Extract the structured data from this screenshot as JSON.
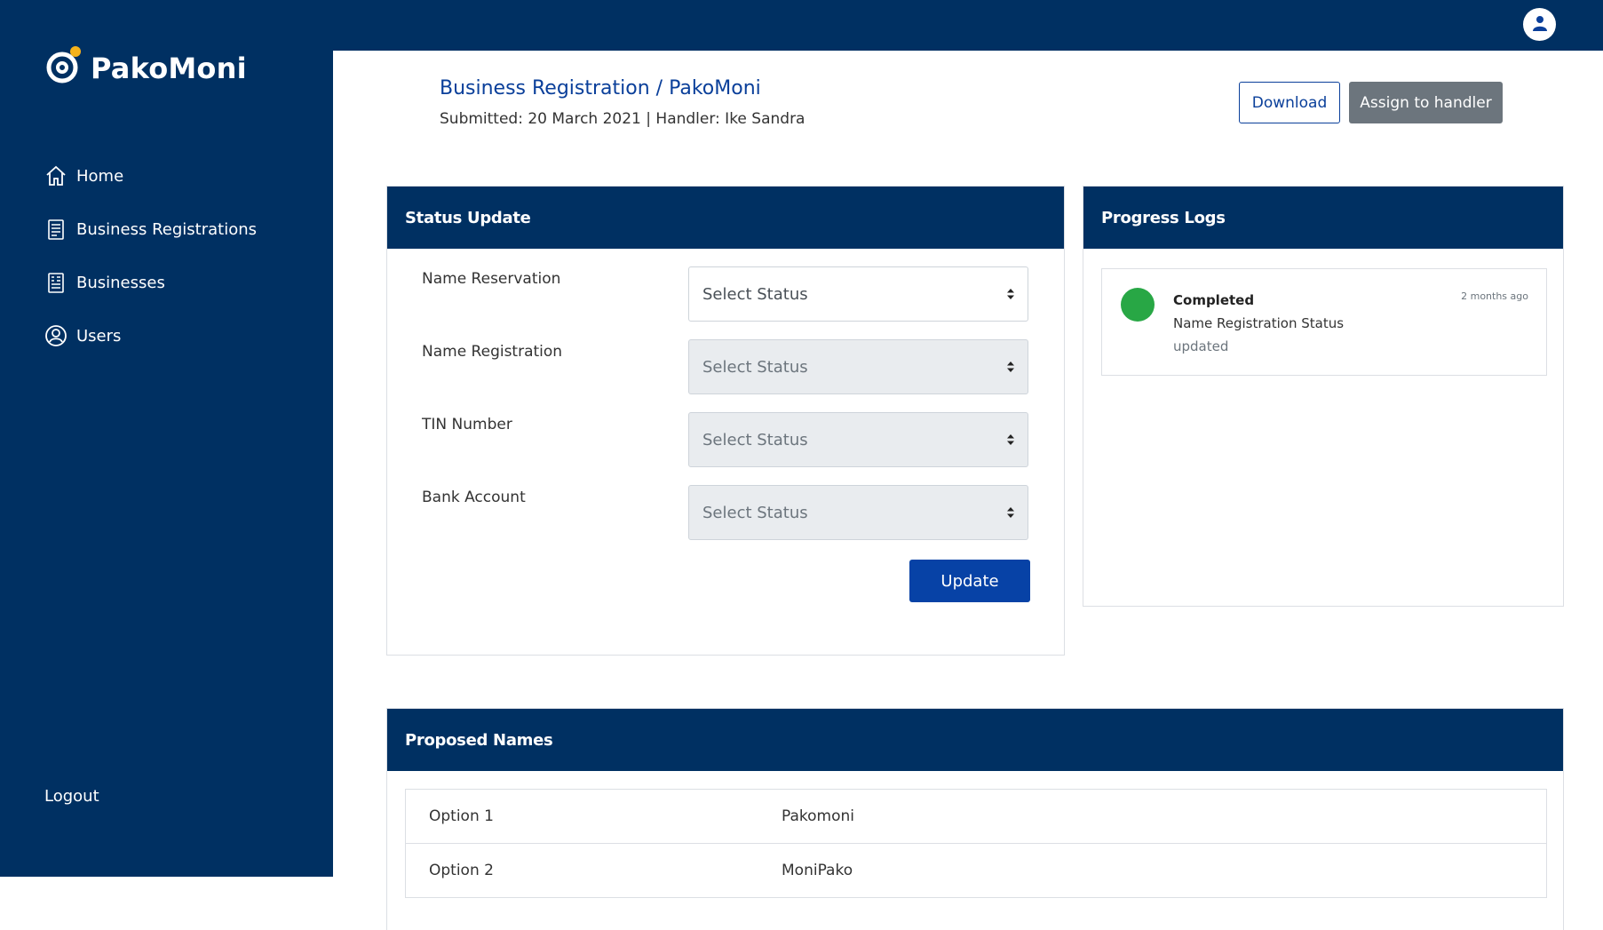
{
  "app": {
    "brand": "PakoMoni",
    "brand_color": "#003062",
    "accent_color": "#0a3f9a"
  },
  "sidebar": {
    "items": [
      {
        "label": "Home",
        "icon": "home-icon"
      },
      {
        "label": "Business Registrations",
        "icon": "document-icon"
      },
      {
        "label": "Businesses",
        "icon": "building-icon"
      },
      {
        "label": "Users",
        "icon": "user-circle-icon"
      }
    ],
    "logout_label": "Logout"
  },
  "header": {
    "title": "Business Registration / PakoMoni",
    "subtitle": "Submitted: 20 March 2021 | Handler: Ike Sandra",
    "download_label": "Download",
    "assign_label": "Assign to handler"
  },
  "status_update": {
    "title": "Status Update",
    "fields": [
      {
        "label": "Name Reservation",
        "value": "Select Status",
        "enabled": true
      },
      {
        "label": "Name Registration",
        "value": "Select Status",
        "enabled": false
      },
      {
        "label": "TIN Number",
        "value": "Select Status",
        "enabled": false
      },
      {
        "label": "Bank Account",
        "value": "Select Status",
        "enabled": false
      }
    ],
    "update_label": "Update"
  },
  "progress_logs": {
    "title": "Progress Logs",
    "entries": [
      {
        "status": "Completed",
        "description": "Name Registration Status",
        "detail": "updated",
        "time": "2 months ago",
        "color": "#28a745"
      }
    ]
  },
  "proposed_names": {
    "title": "Proposed Names",
    "rows": [
      {
        "option": "Option 1",
        "name": "Pakomoni"
      },
      {
        "option": "Option 2",
        "name": "MoniPako"
      }
    ]
  }
}
